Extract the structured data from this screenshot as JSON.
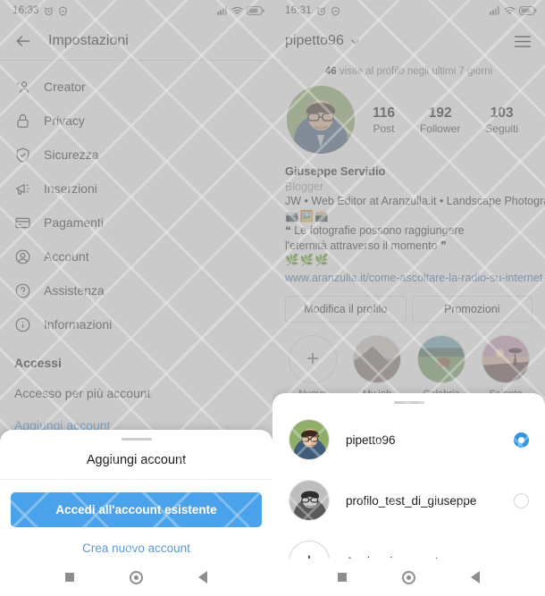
{
  "left": {
    "status": {
      "time": "16:33",
      "icons": [
        "alarm-icon",
        "dnd-icon",
        "signal-icon",
        "wifi-icon",
        "battery-icon"
      ]
    },
    "header": {
      "back_icon": "back-arrow-icon",
      "title": "Impostazioni"
    },
    "settings_items": [
      {
        "label": "Creator",
        "icon": "creator-icon"
      },
      {
        "label": "Privacy",
        "icon": "lock-icon"
      },
      {
        "label": "Sicurezza",
        "icon": "shield-check-icon"
      },
      {
        "label": "Inserzioni",
        "icon": "megaphone-icon"
      },
      {
        "label": "Pagamenti",
        "icon": "credit-card-icon"
      },
      {
        "label": "Account",
        "icon": "account-circle-icon"
      },
      {
        "label": "Assistenza",
        "icon": "help-circle-icon"
      },
      {
        "label": "Informazioni",
        "icon": "info-circle-icon"
      }
    ],
    "section_header": "Accessi",
    "multi_account_row": "Accesso per più account",
    "add_account_link": "Aggiungi account",
    "sheet": {
      "title": "Aggiungi account",
      "primary_button": "Accedi all'account esistente",
      "secondary_link": "Crea nuovo account"
    }
  },
  "right": {
    "status": {
      "time": "16:31",
      "icons": [
        "alarm-icon",
        "dnd-icon",
        "signal-icon",
        "wifi-icon",
        "battery-icon"
      ]
    },
    "header": {
      "username": "pipetto96",
      "chevron": "chevron-down-icon",
      "menu_icon": "hamburger-menu-icon"
    },
    "visits": {
      "count": "46",
      "text": "visite al profilo negli ultimi 7 giorni"
    },
    "stats": [
      {
        "value": "116",
        "label": "Post"
      },
      {
        "value": "192",
        "label": "Follower"
      },
      {
        "value": "103",
        "label": "Seguiti"
      }
    ],
    "bio": {
      "name": "Giuseppe Servidio",
      "category": "Blogger",
      "line1": "JW • Web Editor at Aranzulla.it • Landscape Photographer",
      "emoji_line": "📷🖼️📸",
      "quote_line1": "❝ Le fotografie possono raggiungere",
      "quote_line2": "l'eternità attraverso il momento ❞",
      "emoji_line2": "🌿🌿🌿",
      "url": "www.aranzulla.it/come-ascoltare-la-radio-su-internet-gr..."
    },
    "actions": [
      {
        "label": "Modifica il profilo"
      },
      {
        "label": "Promozioni"
      }
    ],
    "highlights": [
      {
        "label": "Nuovo",
        "type": "add"
      },
      {
        "label": "My job",
        "type": "image"
      },
      {
        "label": "Calabria",
        "type": "image"
      },
      {
        "label": "Salento",
        "type": "image"
      }
    ],
    "account_sheet": {
      "accounts": [
        {
          "name": "pipetto96",
          "selected": true
        },
        {
          "name": "profilo_test_di_giuseppe",
          "selected": false
        }
      ],
      "add_account": "Aggiungi account"
    }
  },
  "navbar": {
    "recents": "recents-square-icon",
    "home": "home-circle-icon",
    "back": "back-triangle-icon"
  },
  "colors": {
    "accent_blue": "#3897f0",
    "button_blue": "#4aa3ea",
    "radio_blue": "#2b95e9",
    "dim": "#aaaaaa"
  }
}
